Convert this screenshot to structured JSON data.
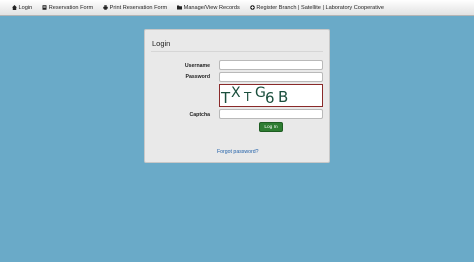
{
  "nav": {
    "items": [
      {
        "label": "Login",
        "icon": "home-icon"
      },
      {
        "label": "Reservation Form",
        "icon": "form-icon"
      },
      {
        "label": "Print Reservation Form",
        "icon": "print-icon"
      },
      {
        "label": "Manage/View Records",
        "icon": "records-icon"
      },
      {
        "label": "Register Branch | Satellite | Laboratory Cooperative",
        "icon": "register-icon"
      }
    ]
  },
  "login": {
    "title": "Login",
    "username_label": "Username",
    "password_label": "Password",
    "captcha_label": "Captcha",
    "captcha_text": [
      "T",
      "X",
      "T",
      "G",
      "6",
      "B"
    ],
    "username_value": "",
    "password_value": "",
    "captcha_value": "",
    "login_button": "Log In",
    "forgot_link": "Forgot password?"
  },
  "colors": {
    "background": "#6aaac8",
    "button": "#2e7d32",
    "link": "#1f5fa8",
    "captcha_text": "#1b4f3d",
    "captcha_border": "#8a2a2a"
  }
}
